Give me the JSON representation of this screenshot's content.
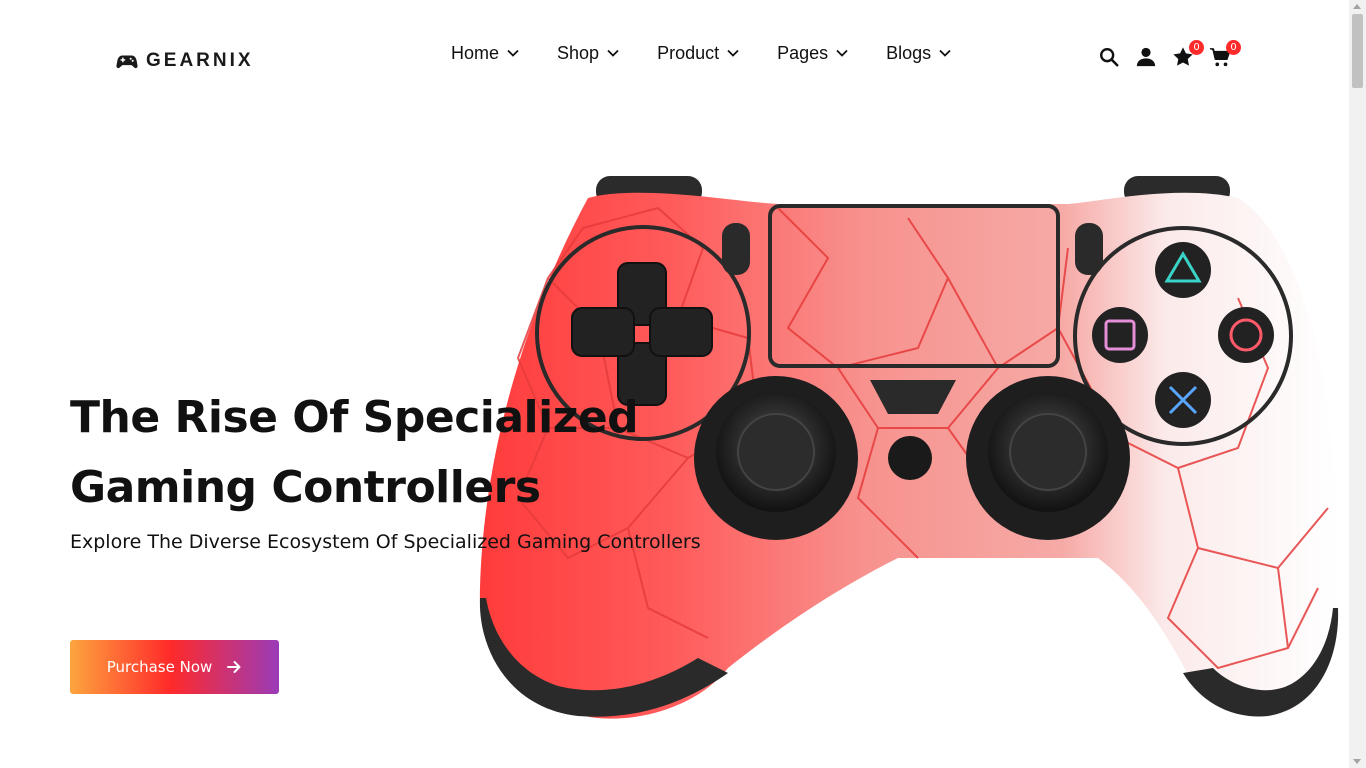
{
  "header": {
    "logo_text": "GEARNIX",
    "logo_icon": "gamepad-icon",
    "nav": [
      {
        "label": "Home"
      },
      {
        "label": "Shop"
      },
      {
        "label": "Product"
      },
      {
        "label": "Pages"
      },
      {
        "label": "Blogs"
      }
    ],
    "actions": {
      "search_icon": "search-icon",
      "account_icon": "user-icon",
      "wishlist_icon": "star-icon",
      "wishlist_count": "0",
      "cart_icon": "cart-icon",
      "cart_count": "0"
    }
  },
  "hero": {
    "title_line1": "The Rise Of Specialized",
    "title_line2": "Gaming Controllers",
    "subtitle": "Explore The Diverse Ecosystem Of Specialized Gaming Controllers",
    "cta_label": "Purchase Now",
    "cta_icon": "arrow-right-icon"
  },
  "colors": {
    "accent_start": "#fda53f",
    "accent_mid": "#ff2a2a",
    "accent_end": "#9a3bb8",
    "badge": "#ff2a2a",
    "text": "#111111"
  }
}
